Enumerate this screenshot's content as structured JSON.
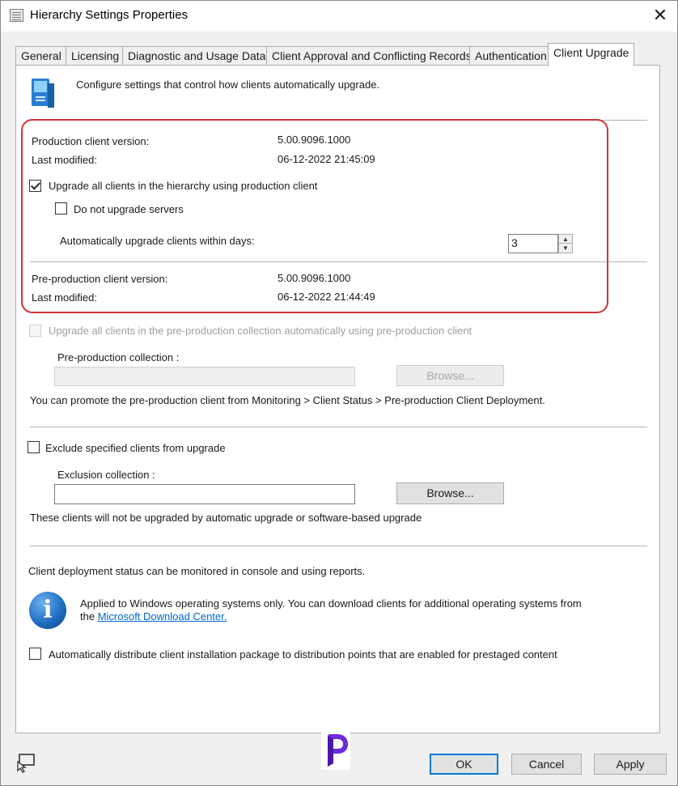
{
  "window": {
    "title": "Hierarchy Settings Properties",
    "close_glyph": "✕"
  },
  "tabs": [
    {
      "label": "General"
    },
    {
      "label": "Licensing"
    },
    {
      "label": "Diagnostic and Usage Data"
    },
    {
      "label": "Client Approval and Conflicting Records"
    },
    {
      "label": "Authentication"
    },
    {
      "label": "Client Upgrade",
      "active": true
    }
  ],
  "header": {
    "description": "Configure settings that control how clients automatically upgrade.",
    "icon": "computer-upgrade-icon"
  },
  "production": {
    "version_label": "Production client version:",
    "version_value": "5.00.9096.1000",
    "modified_label": "Last modified:",
    "modified_value": "06-12-2022 21:45:09",
    "upgrade_all_label": "Upgrade all clients in the hierarchy using production client",
    "upgrade_all_checked": true,
    "no_servers_label": "Do not upgrade servers",
    "no_servers_checked": false,
    "days_label": "Automatically upgrade clients within days:",
    "days_value": "3"
  },
  "preproduction": {
    "version_label": "Pre-production client version:",
    "version_value": "5.00.9096.1000",
    "modified_label": "Last modified:",
    "modified_value": "06-12-2022 21:44:49",
    "upgrade_label": "Upgrade all clients in the pre-production collection automatically using pre-production client",
    "upgrade_checked": false,
    "collection_label": "Pre-production collection :",
    "collection_value": "",
    "browse_label": "Browse...",
    "promote_note": "You can promote the pre-production client from Monitoring > Client Status > Pre-production Client Deployment."
  },
  "exclusion": {
    "exclude_label": "Exclude specified clients from upgrade",
    "exclude_checked": false,
    "collection_label": "Exclusion collection :",
    "collection_value": "",
    "browse_label": "Browse...",
    "note": "These clients will not be upgraded by automatic upgrade or software-based upgrade"
  },
  "deployment": {
    "status_note": "Client deployment status can be monitored in console and using reports.",
    "info_line1": "Applied to Windows operating systems only. You can download clients for additional operating systems from",
    "info_line2_prefix": "the ",
    "download_link": "Microsoft Download Center.",
    "info_icon": "info-icon",
    "distribute_label": "Automatically distribute client installation package to distribution points that are enabled for prestaged content",
    "distribute_checked": false
  },
  "footer": {
    "ok_label": "OK",
    "cancel_label": "Cancel",
    "apply_label": "Apply",
    "help_icon": "help-pointer-icon",
    "logo_icon": "prajwal-logo-icon"
  },
  "colors": {
    "highlight_box": "#d0343a",
    "link": "#0066cc",
    "default_button_border": "#0078d7"
  }
}
